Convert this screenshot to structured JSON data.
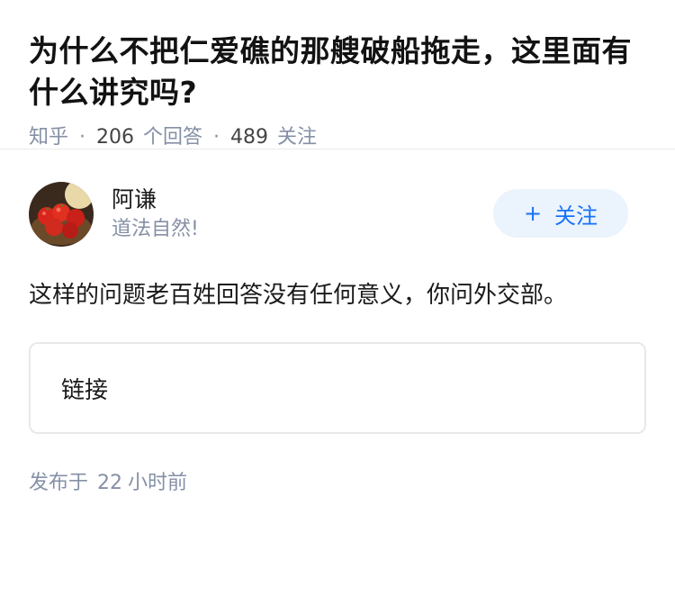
{
  "question": {
    "title": "为什么不把仁爱礁的那艘破船拖走，这里面有什么讲究吗?",
    "source": "知乎",
    "answer_count": "206",
    "answer_count_label": "个回答",
    "follower_count": "489",
    "follower_count_label": "关注"
  },
  "answer": {
    "author_name": "阿谦",
    "author_bio": "道法自然!",
    "follow_label": "关注",
    "follow_icon": "plus-icon",
    "content": "这样的问题老百姓回答没有任何意义，你问外交部。",
    "link_card_label": "链接",
    "publish_prefix": "发布于",
    "publish_num": "22",
    "publish_suffix": "小时前"
  },
  "colors": {
    "accent": "#1772f6",
    "accent_bg": "#ebf3fc",
    "meta": "#8590a6"
  }
}
